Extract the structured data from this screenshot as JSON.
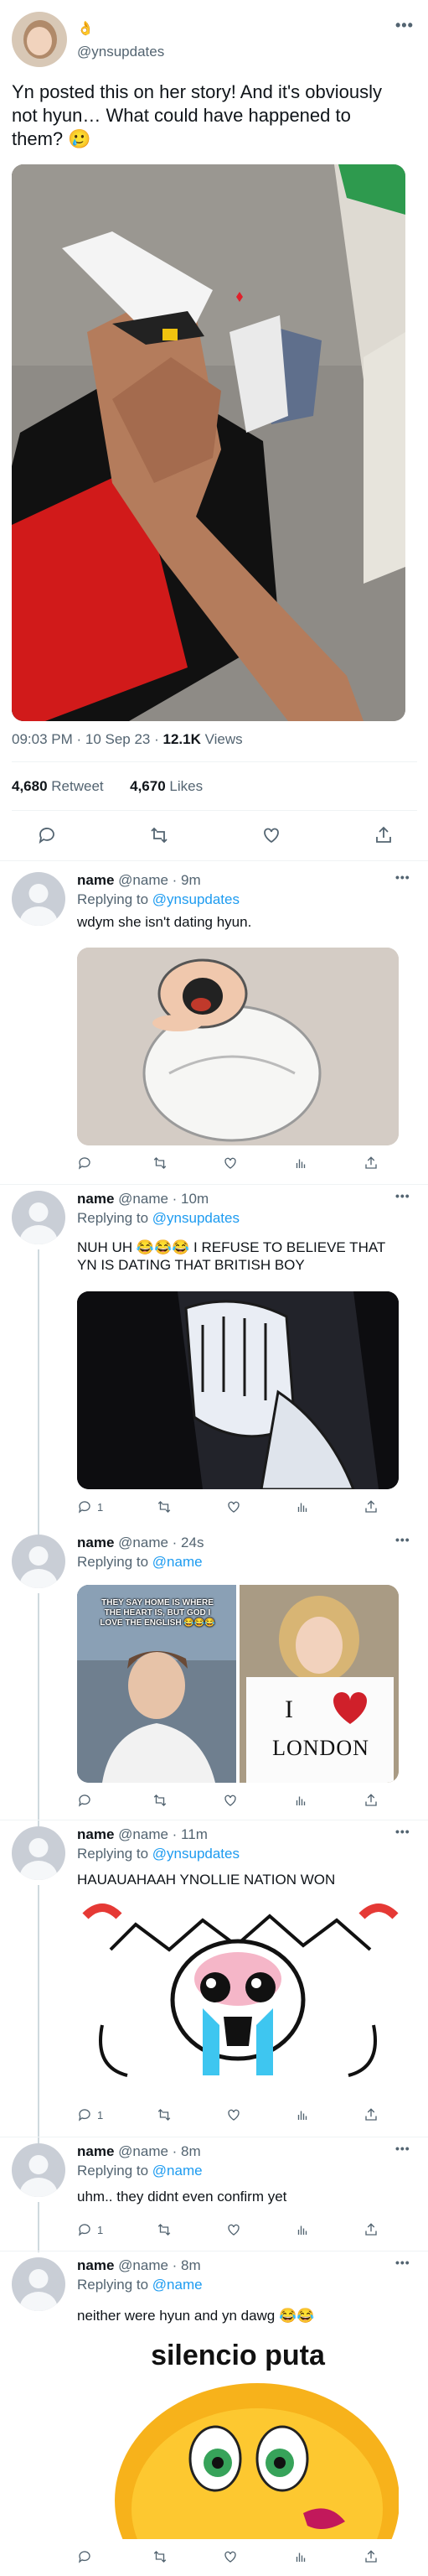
{
  "main_tweet": {
    "badge": "👌",
    "handle": "@ynsupdates",
    "text": "Yn posted this on her story! And it's obviously not hyun… What could have happened to them? 🥲",
    "timestamp": "09:03 PM · 10 Sep 23 · ",
    "views_count": "12.1K",
    "views_label": " Views",
    "retweets_count": "4,680",
    "retweets_label": " Retweet",
    "likes_count": "4,670",
    "likes_label": " Likes"
  },
  "replies": [
    {
      "name": "name",
      "handle": "@name · 9m",
      "replying_prefix": "Replying to ",
      "replying_to": "@ynsupdates",
      "text": "wdym she isn't dating hyun.",
      "reply_count": "",
      "media": "peter-griffin-straitjacket"
    },
    {
      "name": "name",
      "handle": "@name · 10m",
      "replying_prefix": "Replying to ",
      "replying_to": "@ynsupdates",
      "text": "NUH UH 😂😂😂  I REFUSE TO BELIEVE THAT YN IS DATING THAT BRITISH BOY",
      "reply_count": "1",
      "media": "facepalm"
    },
    {
      "name": "name",
      "handle": "@name · 24s",
      "replying_prefix": "Replying to ",
      "replying_to": "@name",
      "text": "",
      "reply_count": "",
      "media_caption": "THEY SAY HOME IS WHERE THE HEART IS, BUT GOD I LOVE THE ENGLISH 😂😂😂",
      "media_sign_top": "I",
      "media_sign_bottom": "LONDON"
    },
    {
      "name": "name",
      "handle": "@name · 11m",
      "replying_prefix": "Replying to ",
      "replying_to": "@ynsupdates",
      "text": "HAUAUAHAAH YNOLLIE NATION WON",
      "reply_count": "1",
      "media": "crying-cartoon"
    },
    {
      "name": "name",
      "handle": "@name · 8m",
      "replying_prefix": "Replying to ",
      "replying_to": "@name",
      "text": "uhm.. they didnt even confirm yet",
      "reply_count": "1"
    },
    {
      "name": "name",
      "handle": "@name · 8m",
      "replying_prefix": "Replying to ",
      "replying_to": "@name",
      "text": "neither were hyun and yn dawg 😂😂",
      "reply_count": "",
      "media_caption": "silencio puta"
    }
  ],
  "colors": {
    "accent": "#1d9bf0",
    "text": "#0f1419",
    "muted": "#536471",
    "divider": "#eff3f4"
  }
}
